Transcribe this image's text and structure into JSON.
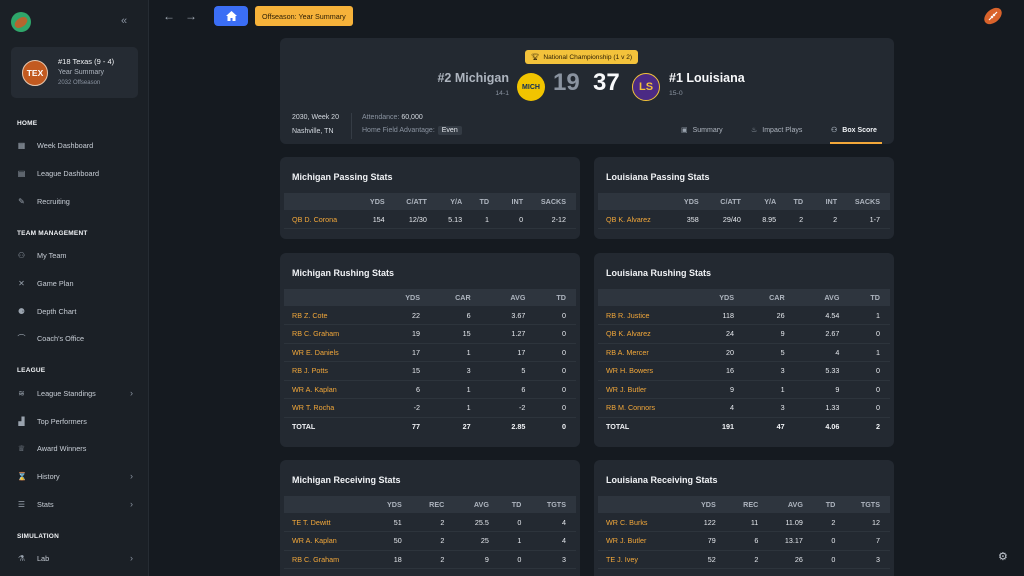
{
  "sidebar": {
    "team": {
      "abbr": "TEX",
      "line1": "#18 Texas (9 - 4)",
      "line2": "Year Summary",
      "line3": "2032 Offseason"
    },
    "sections": [
      {
        "title": "HOME",
        "items": [
          {
            "label": "Week Dashboard",
            "icon": "dashboard-icon"
          },
          {
            "label": "League Dashboard",
            "icon": "newspaper-icon"
          },
          {
            "label": "Recruiting",
            "icon": "recruiting-icon"
          }
        ]
      },
      {
        "title": "TEAM MANAGEMENT",
        "items": [
          {
            "label": "My Team",
            "icon": "users-icon"
          },
          {
            "label": "Game Plan",
            "icon": "play-diagram-icon"
          },
          {
            "label": "Depth Chart",
            "icon": "depth-chart-icon"
          },
          {
            "label": "Coach's Office",
            "icon": "desk-lamp-icon"
          }
        ]
      },
      {
        "title": "LEAGUE",
        "items": [
          {
            "label": "League Standings",
            "icon": "layers-icon",
            "expandable": true
          },
          {
            "label": "Top Performers",
            "icon": "podium-icon"
          },
          {
            "label": "Award Winners",
            "icon": "trophy-icon"
          },
          {
            "label": "History",
            "icon": "history-icon",
            "expandable": true
          },
          {
            "label": "Stats",
            "icon": "database-icon",
            "expandable": true
          }
        ]
      },
      {
        "title": "SIMULATION",
        "items": [
          {
            "label": "Lab",
            "icon": "flask-icon",
            "expandable": true
          }
        ]
      }
    ]
  },
  "topbar": {
    "breadcrumb": "Offseason: Year Summary"
  },
  "game": {
    "badge": "National Championship (1 v 2)",
    "away": {
      "name": "#2 Michigan",
      "record": "14-1",
      "abbr": "MICH",
      "score": "19"
    },
    "home": {
      "name": "#1 Louisiana",
      "record": "15-0",
      "abbr": "LS",
      "score": "37"
    },
    "date": "2030, Week 20",
    "location": "Nashville, TN",
    "attendance_label": "Attendance:",
    "attendance": "60,000",
    "hfa_label": "Home Field Advantage:",
    "hfa": "Even",
    "tabs": [
      "Summary",
      "Impact Plays",
      "Box Score"
    ],
    "active_tab": "Box Score"
  },
  "passing_cols": [
    "",
    "YDS",
    "C/ATT",
    "Y/A",
    "TD",
    "INT",
    "SACKS"
  ],
  "rushing_cols": [
    "",
    "YDS",
    "CAR",
    "AVG",
    "TD"
  ],
  "receiving_cols": [
    "",
    "YDS",
    "REC",
    "AVG",
    "TD",
    "TGTS"
  ],
  "michigan_passing": {
    "title": "Michigan Passing Stats",
    "rows": [
      [
        "QB D. Corona",
        "154",
        "12/30",
        "5.13",
        "1",
        "0",
        "2-12"
      ]
    ]
  },
  "louisiana_passing": {
    "title": "Louisiana Passing Stats",
    "rows": [
      [
        "QB K. Alvarez",
        "358",
        "29/40",
        "8.95",
        "2",
        "2",
        "1-7"
      ]
    ]
  },
  "michigan_rushing": {
    "title": "Michigan Rushing Stats",
    "rows": [
      [
        "RB Z. Cote",
        "22",
        "6",
        "3.67",
        "0"
      ],
      [
        "RB C. Graham",
        "19",
        "15",
        "1.27",
        "0"
      ],
      [
        "WR E. Daniels",
        "17",
        "1",
        "17",
        "0"
      ],
      [
        "RB J. Potts",
        "15",
        "3",
        "5",
        "0"
      ],
      [
        "WR A. Kaplan",
        "6",
        "1",
        "6",
        "0"
      ],
      [
        "WR T. Rocha",
        "-2",
        "1",
        "-2",
        "0"
      ],
      [
        "TOTAL",
        "77",
        "27",
        "2.85",
        "0"
      ]
    ]
  },
  "louisiana_rushing": {
    "title": "Louisiana Rushing Stats",
    "rows": [
      [
        "RB R. Justice",
        "118",
        "26",
        "4.54",
        "1"
      ],
      [
        "QB K. Alvarez",
        "24",
        "9",
        "2.67",
        "0"
      ],
      [
        "RB A. Mercer",
        "20",
        "5",
        "4",
        "1"
      ],
      [
        "WR H. Bowers",
        "16",
        "3",
        "5.33",
        "0"
      ],
      [
        "WR J. Butler",
        "9",
        "1",
        "9",
        "0"
      ],
      [
        "RB M. Connors",
        "4",
        "3",
        "1.33",
        "0"
      ],
      [
        "TOTAL",
        "191",
        "47",
        "4.06",
        "2"
      ]
    ]
  },
  "michigan_receiving": {
    "title": "Michigan Receiving Stats",
    "rows": [
      [
        "TE T. Dewitt",
        "51",
        "2",
        "25.5",
        "0",
        "4"
      ],
      [
        "WR A. Kaplan",
        "50",
        "2",
        "25",
        "1",
        "4"
      ],
      [
        "RB C. Graham",
        "18",
        "2",
        "9",
        "0",
        "3"
      ]
    ]
  },
  "louisiana_receiving": {
    "title": "Louisiana Receiving Stats",
    "rows": [
      [
        "WR C. Burks",
        "122",
        "11",
        "11.09",
        "2",
        "12"
      ],
      [
        "WR J. Butler",
        "79",
        "6",
        "13.17",
        "0",
        "7"
      ],
      [
        "TE J. Ivey",
        "52",
        "2",
        "26",
        "0",
        "3"
      ]
    ]
  }
}
